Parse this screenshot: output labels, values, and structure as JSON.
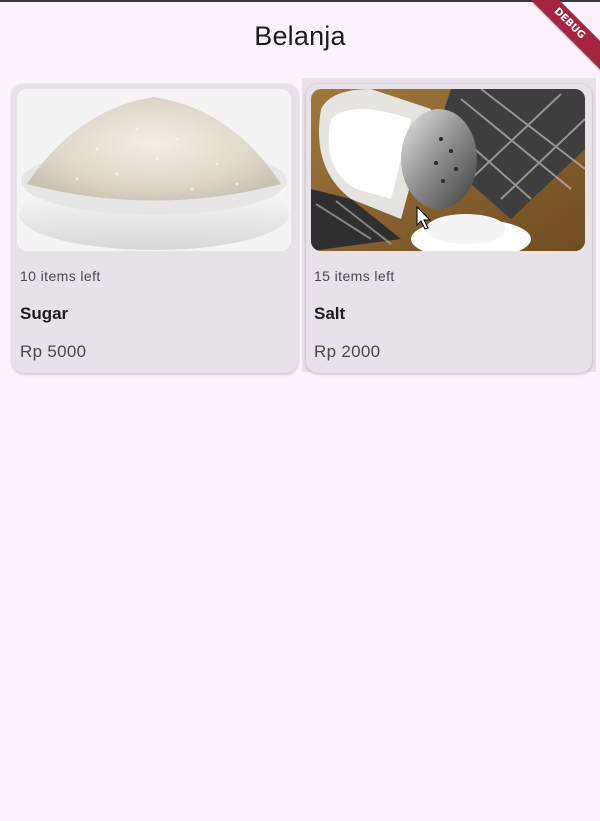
{
  "app_bar": {
    "title": "Belanja"
  },
  "debug_banner": {
    "label": "DEBUG",
    "color": "#a5243f"
  },
  "products": [
    {
      "image": "sugar-bowl-image",
      "stock": "10 items left",
      "name": "Sugar",
      "price": "Rp 5000"
    },
    {
      "image": "salt-shaker-image",
      "stock": "15 items left",
      "name": "Salt",
      "price": "Rp 2000"
    }
  ],
  "colors": {
    "background": "#fdf3fd",
    "card": "#e7e2e8",
    "text": "#1d1b20"
  }
}
